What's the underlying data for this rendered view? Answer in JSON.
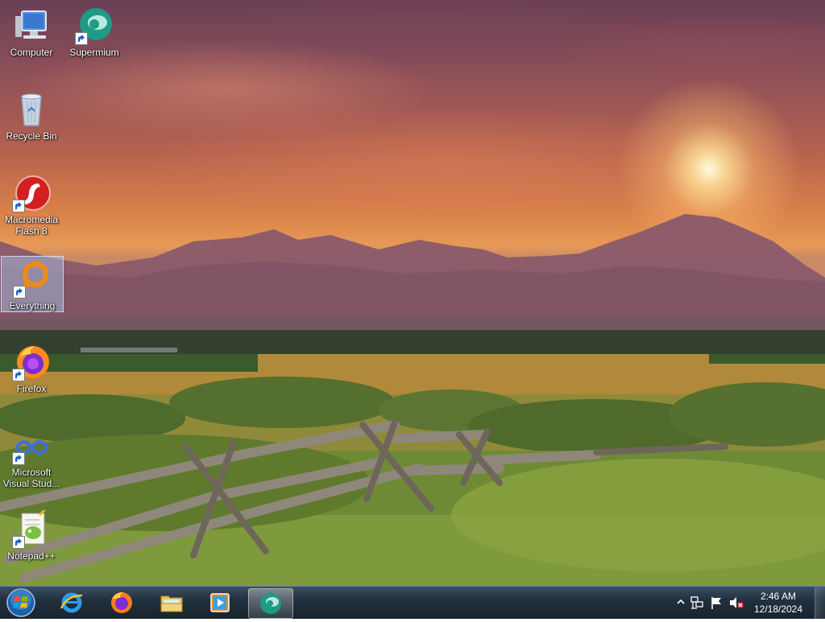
{
  "desktop": {
    "icons": [
      {
        "label": "Computer",
        "icon": "computer-icon"
      },
      {
        "label": "Supermium",
        "icon": "supermium-icon"
      },
      {
        "label": "Recycle Bin",
        "icon": "recycle-bin-icon"
      },
      {
        "label": "Macromedia Flash 8",
        "icon": "flash-icon"
      },
      {
        "label": "Everything",
        "icon": "everything-search-icon"
      },
      {
        "label": "Firefox",
        "icon": "firefox-icon"
      },
      {
        "label": "Microsoft Visual Stud...",
        "icon": "visual-studio-icon"
      },
      {
        "label": "Notepad++",
        "icon": "notepad-plus-plus-icon"
      }
    ]
  },
  "taskbar": {
    "start": {
      "icon": "windows-start-orb-icon"
    },
    "pinned": [
      {
        "name": "Internet Explorer",
        "icon": "internet-explorer-icon"
      },
      {
        "name": "Firefox",
        "icon": "firefox-icon"
      },
      {
        "name": "Windows Explorer",
        "icon": "folder-explorer-icon"
      },
      {
        "name": "Media Player",
        "icon": "media-player-icon"
      },
      {
        "name": "Supermium",
        "icon": "supermium-icon",
        "active": true
      }
    ],
    "tray": {
      "icons": [
        "show-hidden-icons-chevron",
        "network-icon",
        "action-center-flag-icon",
        "volume-muted-icon"
      ],
      "time": "2:46 AM",
      "date": "12/18/2024"
    }
  }
}
